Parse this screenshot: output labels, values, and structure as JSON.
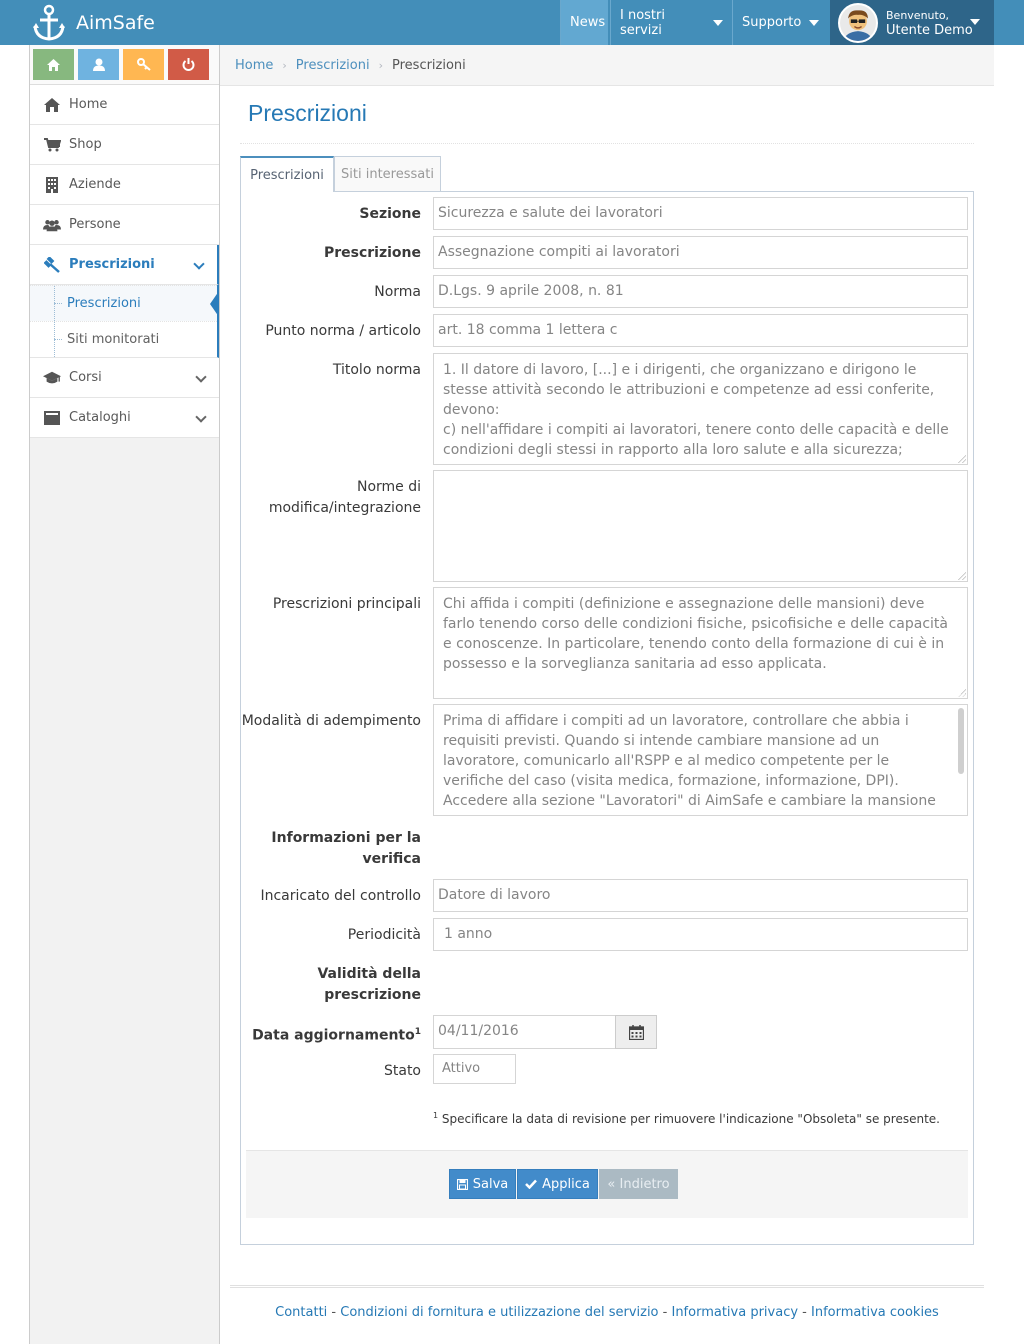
{
  "app": {
    "name": "AimSafe"
  },
  "navbar": {
    "news": "News",
    "services": "I nostri servizi",
    "support": "Supporto",
    "user_greeting": "Benvenuto,",
    "user_name": "Utente Demo"
  },
  "sidebar": {
    "shortcuts": [
      {
        "icon": "home-icon",
        "color": "#87b87f"
      },
      {
        "icon": "user-icon",
        "color": "#6fb3e0"
      },
      {
        "icon": "key-icon",
        "color": "#ffb752"
      },
      {
        "icon": "power-icon",
        "color": "#d15b47"
      }
    ],
    "items": [
      {
        "label": "Home",
        "icon": "home-icon"
      },
      {
        "label": "Shop",
        "icon": "cart-icon"
      },
      {
        "label": "Aziende",
        "icon": "building-icon"
      },
      {
        "label": "Persone",
        "icon": "users-icon"
      },
      {
        "label": "Prescrizioni",
        "icon": "gavel-icon"
      },
      {
        "label": "Corsi",
        "icon": "graduation-icon"
      },
      {
        "label": "Cataloghi",
        "icon": "catalog-icon"
      }
    ],
    "submenu": [
      {
        "label": "Prescrizioni"
      },
      {
        "label": "Siti monitorati"
      }
    ]
  },
  "breadcrumb": {
    "home": "Home",
    "parent": "Prescrizioni",
    "current": "Prescrizioni",
    "separator": "›"
  },
  "page": {
    "title": "Prescrizioni"
  },
  "tabs": [
    {
      "label": "Prescrizioni"
    },
    {
      "label": "Siti interessati"
    }
  ],
  "form": {
    "sezione": {
      "label": "Sezione",
      "value": "Sicurezza e salute dei lavoratori"
    },
    "prescrizione": {
      "label": "Prescrizione",
      "value": "Assegnazione compiti ai lavoratori"
    },
    "norma": {
      "label": "Norma",
      "value": "D.Lgs. 9 aprile 2008, n. 81"
    },
    "punto": {
      "label": "Punto norma / articolo",
      "value": "art. 18 comma 1 lettera c"
    },
    "titolo": {
      "label": "Titolo norma",
      "value": "1. Il datore di lavoro, [...] e i dirigenti, che organizzano e dirigono le stesse attività secondo le attribuzioni e competenze ad essi conferite, devono:\nc) nell'affidare i compiti ai lavoratori, tenere conto delle capacità e delle condizioni degli stessi in rapporto alla loro salute e alla sicurezza;"
    },
    "norme_modifica": {
      "label_line1": "Norme di",
      "label_line2": "modifica/integrazione",
      "value": ""
    },
    "principali": {
      "label": "Prescrizioni principali",
      "value": "Chi affida i compiti (definizione e assegnazione delle mansioni) deve farlo tenendo corso delle condizioni fisiche, psicofisiche e delle capacità e conoscenze. In particolare, tenendo conto della formazione di cui è in possesso e la sorveglianza sanitaria ad esso applicata."
    },
    "modalita": {
      "label": "Modalità di adempimento",
      "value": "Prima di affidare i compiti ad un lavoratore, controllare che abbia i requisiti previsti. Quando si intende cambiare mansione ad un lavoratore, comunicarlo all'RSPP e al medico competente per le verifiche del caso (visita medica, formazione, informazione, DPI).\nAccedere alla sezione \"Lavoratori\" di AimSafe e cambiare la mansione"
    },
    "info_heading_line1": "Informazioni per la",
    "info_heading_line2": "verifica",
    "incaricato": {
      "label": "Incaricato del controllo",
      "value": "Datore di lavoro"
    },
    "periodicita": {
      "label": "Periodicità",
      "value": "1 anno"
    },
    "validita_heading_line1": "Validità della",
    "validita_heading_line2": "prescrizione",
    "data": {
      "label": "Data aggiornamento",
      "sup": "1",
      "value": "04/11/2016"
    },
    "stato": {
      "label": "Stato",
      "value": "Attivo"
    },
    "footnote_sup": "1",
    "footnote": "Specificare la data di revisione per rimuovere l'indicazione \"Obsoleta\" se presente."
  },
  "actions": {
    "save": "Salva",
    "apply": "Applica",
    "back": "« Indietro"
  },
  "footer": {
    "links": [
      "Contatti",
      "Condizioni di fornitura e utilizzazione del servizio",
      "Informativa privacy",
      "Informativa cookies"
    ],
    "separator": " - "
  }
}
